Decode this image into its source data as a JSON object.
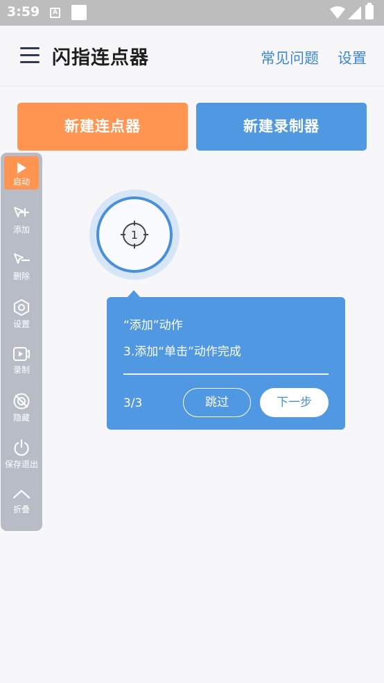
{
  "status_bar": {
    "time": "3:59",
    "notification_icon_letter": "A"
  },
  "header": {
    "title": "闪指连点器",
    "faq_label": "常见问题",
    "settings_label": "设置"
  },
  "main": {
    "new_clicker_label": "新建连点器",
    "new_recorder_label": "新建录制器",
    "new_clicker_color": "#ff9551",
    "new_recorder_color": "#5198e2"
  },
  "toolbar": {
    "items": [
      {
        "label": "启动",
        "icon": "play-icon"
      },
      {
        "label": "添加",
        "icon": "cursor-plus-icon"
      },
      {
        "label": "删除",
        "icon": "cursor-minus-icon"
      },
      {
        "label": "设置",
        "icon": "hexagon-settings-icon"
      },
      {
        "label": "录制",
        "icon": "video-record-icon"
      },
      {
        "label": "隐藏",
        "icon": "hide-icon"
      },
      {
        "label": "保存退出",
        "icon": "power-icon"
      },
      {
        "label": "折叠",
        "icon": "chevron-up-icon"
      }
    ]
  },
  "click_target": {
    "number": "1"
  },
  "guide_tooltip": {
    "title": "“添加”动作",
    "body": "3.添加“单击”动作完成",
    "step": "3/3",
    "skip_label": "跳过",
    "next_label": "下一步"
  }
}
